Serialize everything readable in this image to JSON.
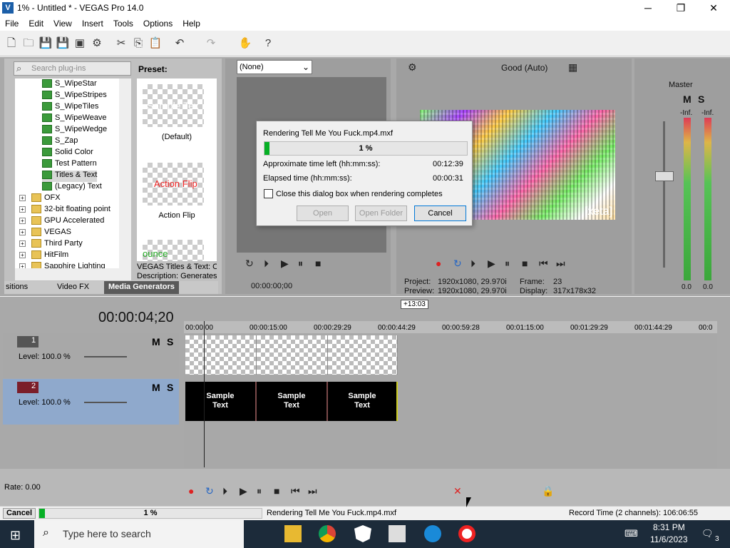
{
  "window": {
    "title": "1% - Untitled * - VEGAS Pro 14.0",
    "minimize": "─",
    "maximize": "❐",
    "close": "✕"
  },
  "menu": [
    "File",
    "Edit",
    "View",
    "Insert",
    "Tools",
    "Options",
    "Help"
  ],
  "explorer": {
    "search_placeholder": "Search plug-ins",
    "tree": [
      {
        "label": "S_WipeStar",
        "kind": "fx"
      },
      {
        "label": "S_WipeStripes",
        "kind": "fx"
      },
      {
        "label": "S_WipeTiles",
        "kind": "fx"
      },
      {
        "label": "S_WipeWeave",
        "kind": "fx"
      },
      {
        "label": "S_WipeWedge",
        "kind": "fx"
      },
      {
        "label": "S_Zap",
        "kind": "fx"
      },
      {
        "label": "Solid Color",
        "kind": "fx"
      },
      {
        "label": "Test Pattern",
        "kind": "fx"
      },
      {
        "label": "Titles & Text",
        "kind": "fx",
        "selected": true
      },
      {
        "label": "(Legacy) Text",
        "kind": "fx"
      },
      {
        "label": "OFX",
        "kind": "folder"
      },
      {
        "label": "32-bit floating point",
        "kind": "folder"
      },
      {
        "label": "GPU Accelerated",
        "kind": "folder"
      },
      {
        "label": "VEGAS",
        "kind": "folder"
      },
      {
        "label": "Third Party",
        "kind": "folder"
      },
      {
        "label": "HitFilm",
        "kind": "folder"
      },
      {
        "label": "Sapphire Lighting",
        "kind": "folder"
      }
    ],
    "preset_label": "Preset:",
    "presets": [
      {
        "thumb_text": "Sample Tex",
        "caption": "(Default)"
      },
      {
        "thumb_text": "Action Flip",
        "caption": "Action Flip"
      },
      {
        "thumb_text": "ounce",
        "caption": ""
      }
    ],
    "description": "VEGAS Titles & Text: O\nDescription: Generates",
    "tabs": [
      "sitions",
      "Video FX",
      "Media Generators"
    ]
  },
  "trimmer": {
    "selector": "(None)",
    "timecode": "00:00:00;00"
  },
  "preview": {
    "quality": "Good (Auto)",
    "watermark": "[xeta]",
    "project_label": "Project:",
    "project_value": "1920x1080, 29.970i",
    "preview_label": "Preview:",
    "preview_value": "1920x1080, 29.970i",
    "frame_label": "Frame:",
    "frame_value": "23",
    "display_label": "Display:",
    "display_value": "317x178x32"
  },
  "mixer": {
    "title": "Master",
    "m": "M",
    "s": "S",
    "left_peak": "-Inf.",
    "right_peak": "-Inf.",
    "scale": [
      "3",
      "6",
      "9",
      "12",
      "15",
      "18",
      "21",
      "24",
      "27",
      "30",
      "33",
      "36",
      "39",
      "42",
      "45",
      "48",
      "51",
      "54",
      "57"
    ],
    "left_level": "0.0",
    "right_level": "0.0"
  },
  "dialog": {
    "title": "Rendering Tell Me You Fuck.mp4.mxf",
    "progress_pct": "1 %",
    "progress_value": 0.01,
    "time_left_label": "Approximate time left (hh:mm:ss):",
    "time_left_value": "00:12:39",
    "elapsed_label": "Elapsed time (hh:mm:ss):",
    "elapsed_value": "00:00:31",
    "close_when_done": "Close this dialog box when rendering completes",
    "open": "Open",
    "open_folder": "Open Folder",
    "cancel": "Cancel"
  },
  "timeline": {
    "timecode": "00:00:04;20",
    "marker": "+13:03",
    "ruler": [
      "00:00:00",
      "00:00:15:00",
      "00:00:29:29",
      "00:00:44:29",
      "00:00:59:28",
      "00:01:15:00",
      "00:01:29:29",
      "00:01:44:29",
      "00:0"
    ],
    "tracks": [
      {
        "num": "1",
        "level": "Level: 100.0 %",
        "m": "M",
        "s": "S"
      },
      {
        "num": "2",
        "level": "Level: 100.0 %",
        "m": "M",
        "s": "S"
      }
    ],
    "text_events": [
      "Sample\nText",
      "Sample\nText",
      "Sample\nText"
    ],
    "rate": "Rate: 0.00"
  },
  "status": {
    "cancel": "Cancel",
    "pct": "1 %",
    "progress_value": 0.01,
    "message": "Rendering Tell Me You Fuck.mp4.mxf",
    "record_time": "Record Time (2 channels): 106:06:55"
  },
  "taskbar": {
    "search_placeholder": "Type here to search",
    "time": "8:31 PM",
    "date": "11/6/2023",
    "notif": "3"
  }
}
